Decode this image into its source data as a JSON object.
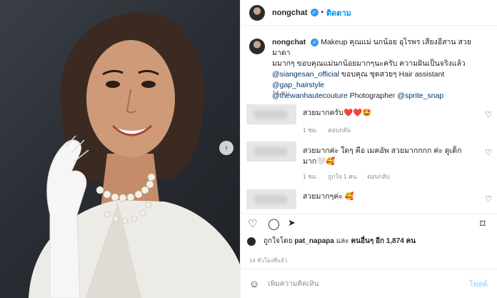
{
  "post": {
    "username": "nongchat",
    "follow_label": "ติดตาม",
    "verified_glyph": "✓"
  },
  "caption": {
    "username": "nongchat",
    "line1": "Makeup คุณแม่ นกน้อย อุไรพร เสียงอีสาน สวยมาดา",
    "line2": "มมากๆ ขอบคุณแม่นกน้อยมากๆนะครับ ความฝันเป็นจริงแล้ว",
    "mention1": "@siangesan_official",
    "line3_mid": " ขอบคุณ ชุดสวยๆ Hair assistant ",
    "mention2": "@gap_hairstyle",
    "mention3": "@thewanhautecouture",
    "line4_mid": " Photographer ",
    "mention4": "@sprite_snap",
    "time": "14 ชม."
  },
  "comments": [
    {
      "text": "สวยมากครับ❤️❤️🤩",
      "meta_time": "1 ชม.",
      "meta_likes": "",
      "reply": "ตอบกลับ"
    },
    {
      "text": "สวยมากค่ะ ใดๆ คือ เมคอัพ สวยมากกกก ค่ะ ดูเด็กมาก🤍🥰",
      "meta_time": "1 ชม.",
      "meta_likes": "ถูกใจ 1 คน",
      "reply": "ตอบกลับ"
    },
    {
      "text": "สวยมากๆค่ะ 🥰",
      "meta_time": "",
      "meta_likes": "",
      "reply": ""
    }
  ],
  "likes": {
    "prefix": "ถูกใจโดย ",
    "user": "pat_napapa",
    "middle": " และ ",
    "others": "คนอื่นๆ อีก 1,874 คน"
  },
  "post_time": "14 ชั่วโมงที่แล้ว",
  "add_comment": {
    "placeholder": "เพิ่มความคิดเห็น",
    "post_label": "โพสต์"
  },
  "icons": {
    "heart": "♡",
    "comment": "◯",
    "share": "➤",
    "save": "⌑",
    "emoji": "☺",
    "next": "›"
  },
  "colors": {
    "link": "#00376b",
    "follow": "#0095f6",
    "verified": "#3897f0"
  }
}
